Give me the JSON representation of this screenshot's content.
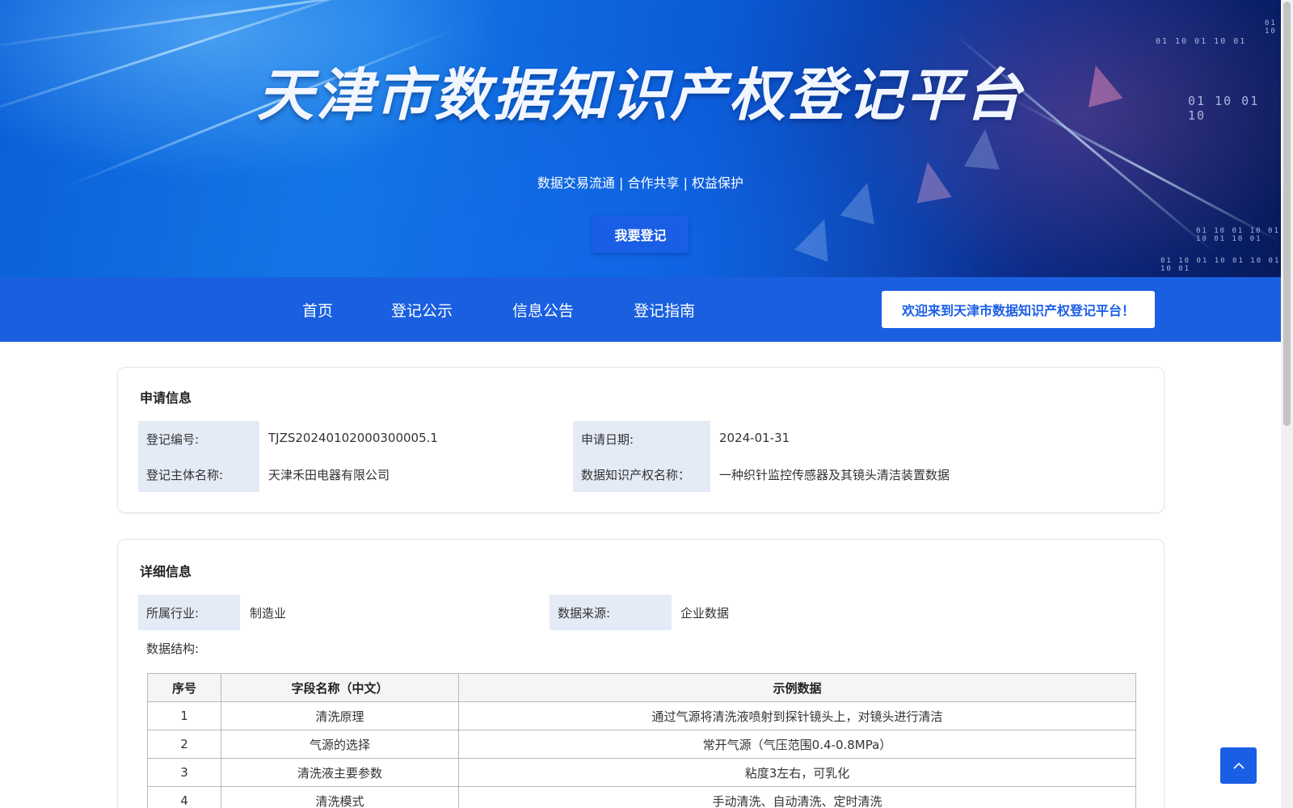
{
  "banner": {
    "title": "天津市数据知识产权登记平台",
    "subtitle": "数据交易流通 | 合作共享 | 权益保护",
    "register_button": "我要登记",
    "binary_text": [
      "01 10",
      "01 10 01 10",
      "01 10 01 10 01",
      "01 10 01 10 01 10 01 10 01",
      "01 10 01 10 01 10 01 10 01"
    ]
  },
  "nav": {
    "items": [
      "首页",
      "登记公示",
      "信息公告",
      "登记指南"
    ],
    "welcome": "欢迎来到天津市数据知识产权登记平台！"
  },
  "application": {
    "title": "申请信息",
    "reg_no_label": "登记编号:",
    "reg_no": "TJZS20240102000300005.1",
    "apply_date_label": "申请日期:",
    "apply_date": "2024-01-31",
    "subject_label": "登记主体名称:",
    "subject": "天津禾田电器有限公司",
    "ip_name_label": "数据知识产权名称：",
    "ip_name": "一种织针监控传感器及其镜头清洁装置数据"
  },
  "details": {
    "title": "详细信息",
    "industry_label": "所属行业:",
    "industry": "制造业",
    "source_label": "数据来源:",
    "source": "企业数据",
    "structure_label": "数据结构:",
    "table": {
      "headers": [
        "序号",
        "字段名称（中文）",
        "示例数据"
      ],
      "rows": [
        [
          "1",
          "清洗原理",
          "通过气源将清洗液喷射到探针镜头上，对镜头进行清洁"
        ],
        [
          "2",
          "气源的选择",
          "常开气源（气压范围0.4-0.8MPa）"
        ],
        [
          "3",
          "清洗液主要参数",
          "粘度3左右，可乳化"
        ],
        [
          "4",
          "清洗模式",
          "手动清洗、自动清洗、定时清洗"
        ]
      ]
    }
  },
  "colors": {
    "primary": "#1a5fe0",
    "label_bg": "#e4ebf7"
  },
  "icons": {
    "back_to_top": "chevron-up-icon"
  }
}
